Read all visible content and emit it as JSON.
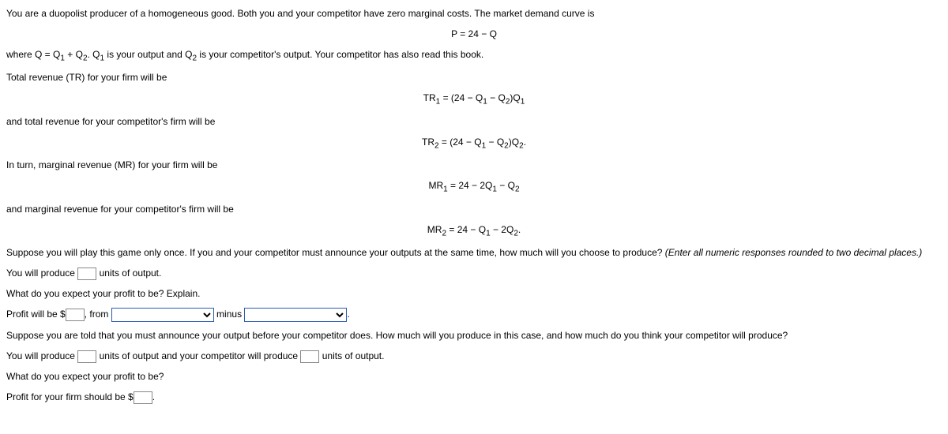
{
  "p1": "You are a duopolist producer of a homogeneous good.  Both you and your competitor have zero marginal costs.  The market demand curve is",
  "eq1": "P = 24 − Q",
  "p2_pre": "where Q = Q",
  "p2_sub1": "1",
  "p2_mid1": " + Q",
  "p2_sub2": "2",
  "p2_mid2": ".  Q",
  "p2_sub3": "1",
  "p2_mid3": " is your output and Q",
  "p2_sub4": "2",
  "p2_post": " is your competitor's output.  Your competitor has also read this book.",
  "p3": "Total revenue (TR) for your firm will be",
  "eq2_pre": "TR",
  "eq2_sub1": "1",
  "eq2_mid1": " = (24 − Q",
  "eq2_sub2": "1",
  "eq2_mid2": " − Q",
  "eq2_sub3": "2",
  "eq2_mid3": ")Q",
  "eq2_sub4": "1",
  "p4": "and total revenue for your competitor's firm will be",
  "eq3_pre": "TR",
  "eq3_sub1": "2",
  "eq3_mid1": " = (24 − Q",
  "eq3_sub2": "1",
  "eq3_mid2": " − Q",
  "eq3_sub3": "2",
  "eq3_mid3": ")Q",
  "eq3_sub4": "2",
  "eq3_post": ".",
  "p5": "In turn, marginal revenue (MR) for your firm will be",
  "eq4_pre": "MR",
  "eq4_sub1": "1",
  "eq4_mid1": " = 24 − 2Q",
  "eq4_sub2": "1",
  "eq4_mid2": " − Q",
  "eq4_sub3": "2",
  "p6": "and marginal revenue for your competitor's firm will be",
  "eq5_pre": "MR",
  "eq5_sub1": "2",
  "eq5_mid1": " = 24 − Q",
  "eq5_sub2": "1",
  "eq5_mid2": " − 2Q",
  "eq5_sub3": "2",
  "eq5_post": ".",
  "p7a": "Suppose you will play this game only once.  If you and your competitor must announce your outputs at the same time, how much will you choose to produce? ",
  "p7b": "(Enter all numeric responses rounded to two decimal places.)",
  "p8a": "You will produce ",
  "p8b": " units of output.",
  "p9": "What do you expect your profit to be?  Explain.",
  "p10a": "Profit will be $",
  "p10b": ", from ",
  "p10c": " minus ",
  "p10d": ".",
  "p11": "Suppose you are told that you must announce your output before your competitor does.  How much will you produce in this case, and how much do you think your competitor will produce?",
  "p12a": "You will produce ",
  "p12b": " units of output and your competitor will produce ",
  "p12c": " units of output.",
  "p13": "What do you expect your profit to be?",
  "p14a": "Profit for your firm should be $",
  "p14b": "."
}
